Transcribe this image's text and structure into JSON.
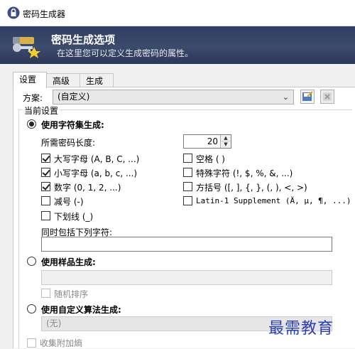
{
  "window": {
    "title": "密码生成器"
  },
  "banner": {
    "title": "密码生成选项",
    "subtitle": "在这里您可以定义生成密码的属性。"
  },
  "tabs": [
    {
      "label": "设置"
    },
    {
      "label": "高级"
    },
    {
      "label": "生成"
    }
  ],
  "profile": {
    "label": "方案:",
    "value": "(自定义)"
  },
  "current_settings": {
    "label": "当前设置"
  },
  "charset": {
    "radio_label": "使用字符集生成:",
    "selected": true,
    "length_label": "所需密码长度:",
    "length_value": "20",
    "options_left": [
      {
        "label": "大写字母 (A, B, C, ...)",
        "checked": true
      },
      {
        "label": "小写字母 (a, b, c, ...)",
        "checked": true
      },
      {
        "label": "数字 (0, 1, 2, ...)",
        "checked": true
      },
      {
        "label": "减号 (-)",
        "checked": false
      },
      {
        "label": "下划线 (_)",
        "checked": false
      }
    ],
    "options_right": [
      {
        "label": "空格 ( )",
        "checked": false
      },
      {
        "label": "特殊字符 (!, $, %, &, ...)",
        "checked": false
      },
      {
        "label": "方括号 ([, ], {, }, (, ), <, >)",
        "checked": false
      },
      {
        "label": "Latin-1 Supplement (Ä, µ, ¶, ...)",
        "checked": false
      }
    ],
    "include_label": "同时包括下列字符:",
    "include_value": ""
  },
  "pattern": {
    "radio_label": "使用样品生成:",
    "value": "",
    "random_label": "随机排序"
  },
  "custom_algo": {
    "radio_label": "使用自定义算法生成:",
    "value": "(无)"
  },
  "entropy": {
    "label": "收集附加熵"
  },
  "watermark": "最需教育"
}
